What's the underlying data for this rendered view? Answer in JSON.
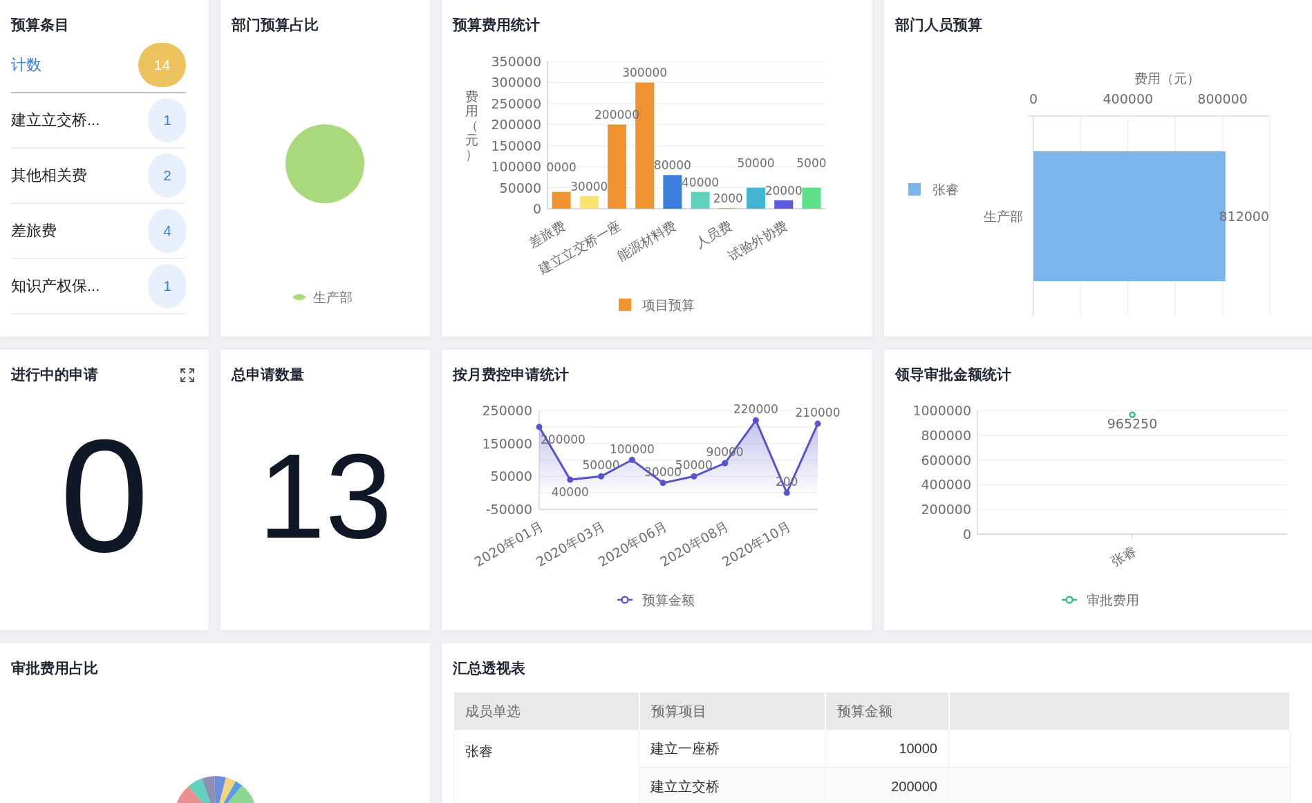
{
  "budget_items": {
    "title": "预算条目",
    "total": {
      "label": "计数",
      "count": "14"
    },
    "items": [
      {
        "label": "建立立交桥...",
        "count": "1"
      },
      {
        "label": "其他相关费",
        "count": "2"
      },
      {
        "label": "差旅费",
        "count": "4"
      },
      {
        "label": "知识产权保...",
        "count": "1"
      }
    ]
  },
  "dept_budget_share": {
    "title": "部门预算占比",
    "slices": [
      {
        "label": "生产部",
        "color": "#a9d97a"
      }
    ]
  },
  "budget_cost_stats": {
    "title": "预算费用统计",
    "chart_data": {
      "type": "bar",
      "ylabel": "费用（元）",
      "categories": [
        "差旅费",
        null,
        "建立立交桥一座",
        null,
        "能源材料费",
        null,
        "人员费",
        null,
        "试验外协费",
        null
      ],
      "ylim": [
        0,
        350000
      ],
      "yticks": [
        0,
        50000,
        100000,
        150000,
        200000,
        250000,
        300000,
        350000
      ],
      "grid": true,
      "series": [
        {
          "name": "项目预算",
          "color": "#f0922f",
          "values": [
            40000,
            30000,
            200000,
            300000,
            80000,
            40000,
            2000,
            50000,
            20000,
            50000
          ],
          "colors": [
            "#f0922f",
            "#fbe36e",
            "#f0922f",
            "#f0922f",
            "#3b7ddd",
            "#5fd3be",
            "#f4b04a",
            "#43b5d1",
            "#5b5bdb",
            "#5ee08a"
          ]
        }
      ],
      "value_labels": [
        "0000",
        "30000",
        "200000",
        "300000",
        "80000",
        "40000",
        "2000",
        "50000",
        "20000",
        "5000"
      ]
    }
  },
  "dept_staff_budget": {
    "title": "部门人员预算",
    "chart_data": {
      "type": "bar",
      "orientation": "horizontal",
      "xlabel": "费用（元）",
      "categories": [
        "生产部"
      ],
      "xlim": [
        0,
        1000000
      ],
      "xticks": [
        0,
        400000,
        800000
      ],
      "series": [
        {
          "name": "张睿",
          "color": "#7cb5ec",
          "values": [
            812000
          ]
        }
      ],
      "value_labels": [
        "812000"
      ]
    }
  },
  "ongoing_applications": {
    "title": "进行中的申请",
    "value": "0"
  },
  "total_applications": {
    "title": "总申请数量",
    "value": "13"
  },
  "monthly_cost_control": {
    "title": "按月费控申请统计",
    "chart_data": {
      "type": "area",
      "marker": true,
      "categories": [
        "2020年01月",
        null,
        "2020年03月",
        null,
        "2020年06月",
        null,
        "2020年08月",
        null,
        "2020年10月",
        null
      ],
      "ylim": [
        -50000,
        250000
      ],
      "yticks": [
        -50000,
        50000,
        150000,
        250000
      ],
      "series": [
        {
          "name": "预算金额",
          "color": "#5553ce",
          "values": [
            200000,
            40000,
            50000,
            100000,
            30000,
            50000,
            90000,
            220000,
            200,
            210000
          ]
        }
      ],
      "value_labels": [
        "200000",
        "40000",
        "50000",
        "100000",
        "30000",
        "50000",
        "90000",
        "220000",
        "200",
        "210000"
      ]
    }
  },
  "leader_approval": {
    "title": "领导审批金额统计",
    "chart_data": {
      "type": "line",
      "grid": true,
      "marker": true,
      "categories": [
        "张睿"
      ],
      "ylim": [
        0,
        1000000
      ],
      "yticks": [
        0,
        200000,
        400000,
        600000,
        800000,
        1000000
      ],
      "series": [
        {
          "name": "审批费用",
          "color": "#3fb68e",
          "values": [
            965250
          ]
        }
      ],
      "value_labels": [
        "965250"
      ]
    }
  },
  "approval_share": {
    "title": "审批费用占比"
  },
  "pivot_table": {
    "title": "汇总透视表",
    "columns": [
      "成员单选",
      "预算项目",
      "预算金额"
    ],
    "groups": [
      {
        "member": "张睿",
        "rows": [
          {
            "item": "建立一座桥",
            "amount": "10000"
          },
          {
            "item": "建立立交桥",
            "amount": "200000"
          }
        ]
      }
    ]
  }
}
